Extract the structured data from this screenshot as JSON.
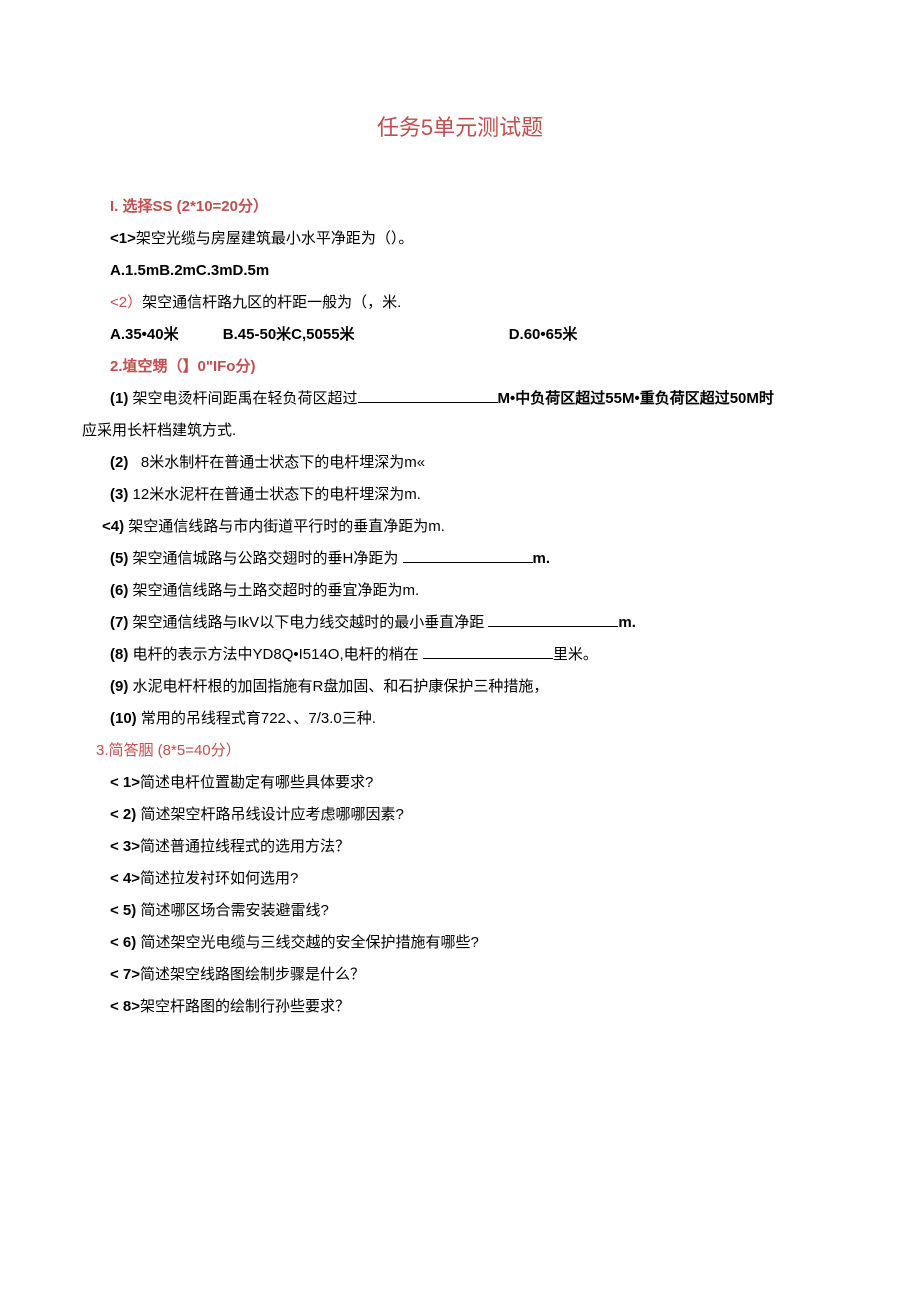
{
  "title": "任务5单元测试题",
  "section1": {
    "header": "I. 选择SS  (2*10=20分）",
    "q1": {
      "num": "<1>",
      "text": "架空光缆与房屋建筑最小水平净距为（）。",
      "opts": "A.1.5mB.2mC.3mD.5m"
    },
    "q2": {
      "num": "<2）",
      "text": "架空通信杆路九区的杆距一般为（，米.",
      "opts": {
        "a": "A.35•40米",
        "b": "B.45-50米C,5055米",
        "d": "D.60•65米"
      }
    }
  },
  "section2": {
    "header": "2.埴空甥（】0\"IFo分)",
    "q1": {
      "num": "(1)",
      "t1": "架空电烫杆间距禹在轻负荷区超过",
      "t2": "M•中负荷区超过55M•重负荷区超过50M时",
      "t3": "应采用长杆档建筑方式."
    },
    "q2": {
      "num": "(2)",
      "text": "8米水制杆在普通士状态下的电杆埋深为m«"
    },
    "q3": {
      "num": "(3)",
      "text": "12米水泥杆在普通士状态下的电杆埋深为m."
    },
    "q4": {
      "num": "<4)",
      "text": "架空通信线路与市内街道平行时的垂直净距为m."
    },
    "q5": {
      "num": "(5)",
      "t1": "架空通信城路与公路交翅时的垂H净距为",
      "t2": "m."
    },
    "q6": {
      "num": "(6)",
      "text": "架空通信线路与土路交超时的垂宜净距为m."
    },
    "q7": {
      "num": "(7)",
      "t1": "架空通信线路与IkV以下电力线交越时的最小垂直净距",
      "t2": "m."
    },
    "q8": {
      "num": "(8)",
      "t1": "电杆的表示方法中YD8Q•I514O,电杆的梢在",
      "t2": "里米。"
    },
    "q9": {
      "num": "(9)",
      "text": "水泥电杆杆根的加固指施有R盘加固、和石护康保护三种措施，"
    },
    "q10": {
      "num": "(10)",
      "text": "常用的吊线程式育722、、7/3.0三种."
    }
  },
  "section3": {
    "header": "3.简答胭  (8*5=40分）",
    "q1": {
      "num": "<  1>",
      "text": "简述电杆位置勘定有哪些具体要求?"
    },
    "q2": {
      "num": "<  2)",
      "text": "简述架空杆路吊线设计应考虑哪哪因素?"
    },
    "q3": {
      "num": "<  3>",
      "text": "简述普通拉线程式的选用方法？"
    },
    "q4": {
      "num": "<  4>",
      "text": "简述拉发衬环如何选用?"
    },
    "q5": {
      "num": "<  5)",
      "text": "简述哪区场合需安装避雷线?"
    },
    "q6": {
      "num": "<  6)",
      "text": "简述架空光电缆与三线交越的安全保护措施有哪些?"
    },
    "q7": {
      "num": "<  7>",
      "text": "简述架空线路图绘制步骤是什么？"
    },
    "q8": {
      "num": "<  8>",
      "text": "架空杆路图的绘制行孙些要求？"
    }
  }
}
